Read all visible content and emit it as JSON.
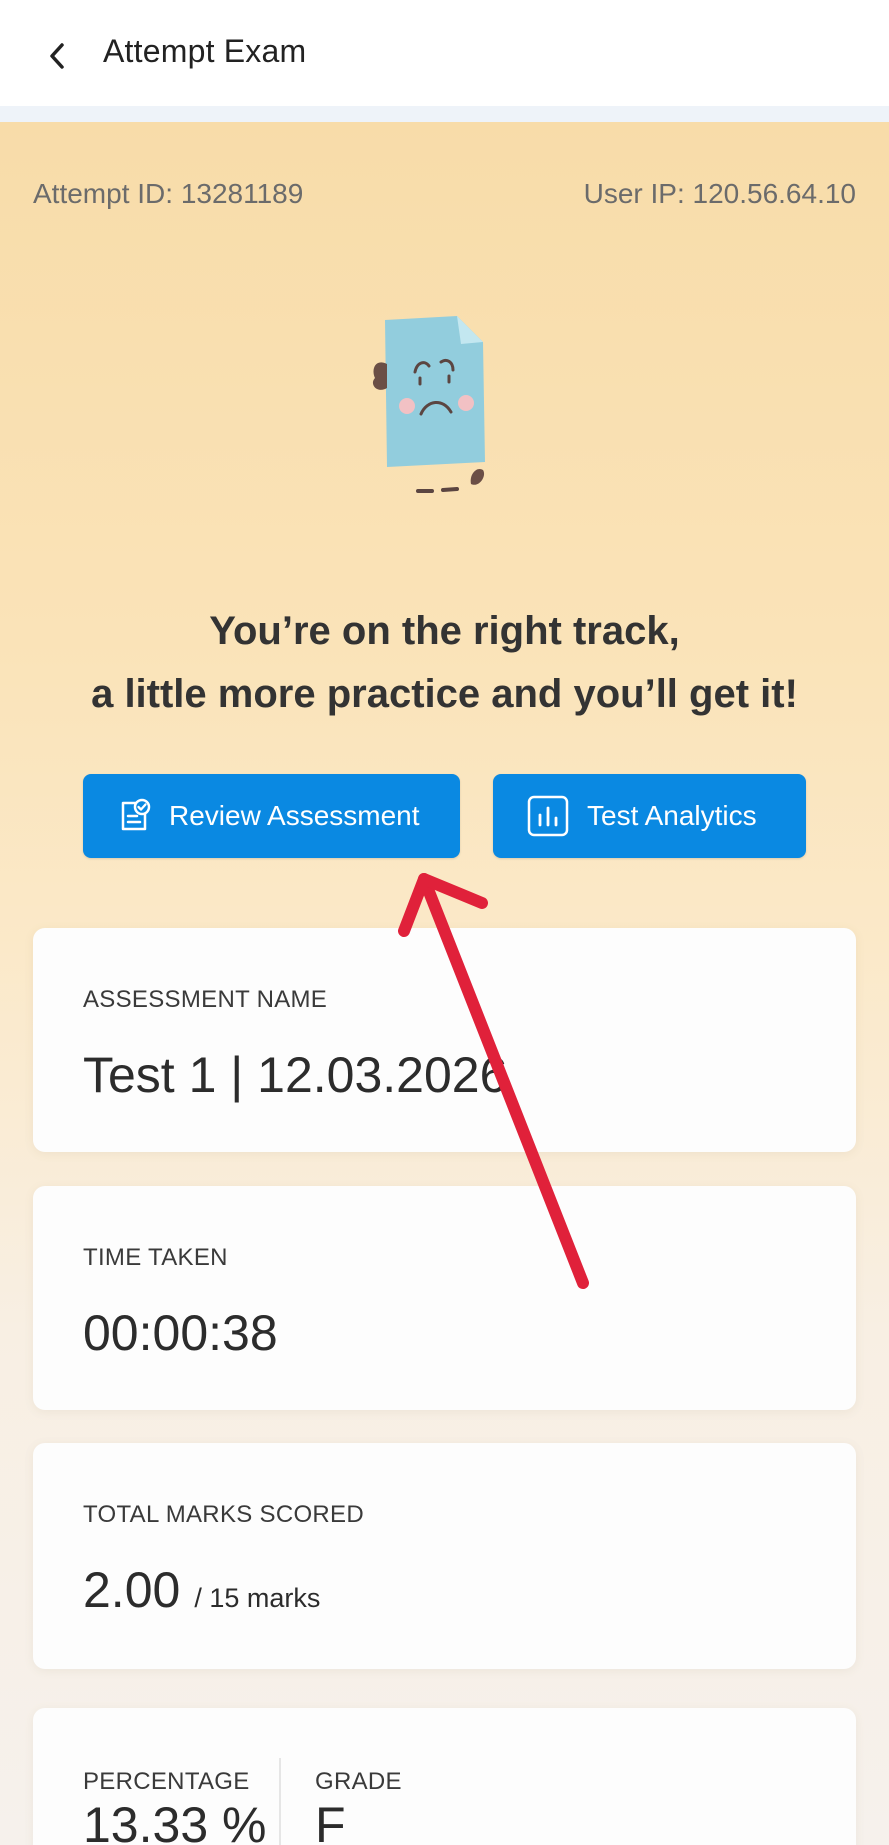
{
  "appbar": {
    "title": "Attempt Exam",
    "back_icon": "chevron-left-icon"
  },
  "meta": {
    "attempt_id": "Attempt ID: 13281189",
    "user_ip": "User IP: 120.56.64.10"
  },
  "message": {
    "line1": "You’re on the right track,",
    "line2": "a little more practice and you’ll get it!"
  },
  "buttons": {
    "review_label": "Review Assessment",
    "review_icon": "clipboard-check-icon",
    "analytics_label": "Test Analytics",
    "analytics_icon": "bar-chart-icon"
  },
  "cards": {
    "assessment": {
      "label": "ASSESSMENT NAME",
      "value": "Test 1 | 12.03.2026"
    },
    "time": {
      "label": "TIME TAKEN",
      "value": "00:00:38"
    },
    "marks": {
      "label": "TOTAL MARKS SCORED",
      "value": "2.00",
      "suffix": "/ 15 marks"
    },
    "percentage": {
      "label": "PERCENTAGE",
      "value": "13.33 %"
    },
    "grade": {
      "label": "GRADE",
      "value": "F"
    }
  },
  "colors": {
    "primary_button": "#0a89e2",
    "annotation_arrow": "#e0213a",
    "hero_top": "#f8dca9"
  }
}
